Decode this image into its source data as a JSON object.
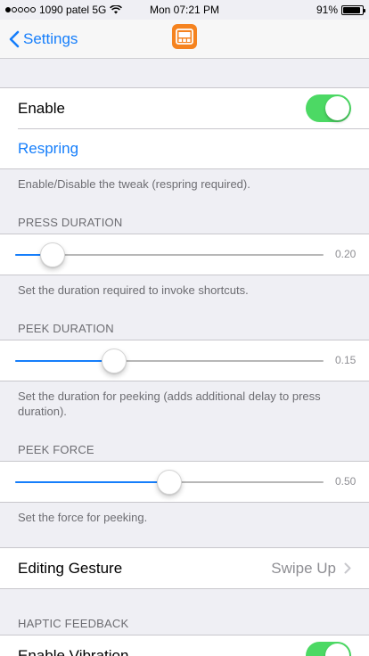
{
  "status_bar": {
    "carrier": "1090 patel 5G",
    "time": "Mon 07:21 PM",
    "battery": "91%",
    "battery_level": 0.91,
    "signal_bars_filled": 1,
    "signal_bars_total": 5
  },
  "nav": {
    "back_label": "Settings",
    "app_icon": "tweak-app-icon",
    "accent": "#157efb",
    "icon_color": "#f5831f"
  },
  "enable_group": {
    "enable_label": "Enable",
    "enable_on": true,
    "respring_label": "Respring",
    "footer": "Enable/Disable the tweak (respring required)."
  },
  "press_duration": {
    "header": "PRESS DURATION",
    "value_text": "0.20",
    "fraction": 0.12,
    "footer": "Set the duration required to invoke shortcuts."
  },
  "peek_duration": {
    "header": "PEEK DURATION",
    "value_text": "0.15",
    "fraction": 0.32,
    "footer": "Set the duration for peeking (adds additional delay to press duration)."
  },
  "peek_force": {
    "header": "PEEK FORCE",
    "value_text": "0.50",
    "fraction": 0.5,
    "footer": "Set the force for peeking."
  },
  "editing_gesture": {
    "label": "Editing Gesture",
    "value": "Swipe Up"
  },
  "haptic": {
    "header": "HAPTIC FEEDBACK",
    "vibration_label": "Enable Vibration",
    "vibration_on": true
  },
  "colors": {
    "toggle_on": "#4cd964",
    "background": "#efeff4"
  }
}
